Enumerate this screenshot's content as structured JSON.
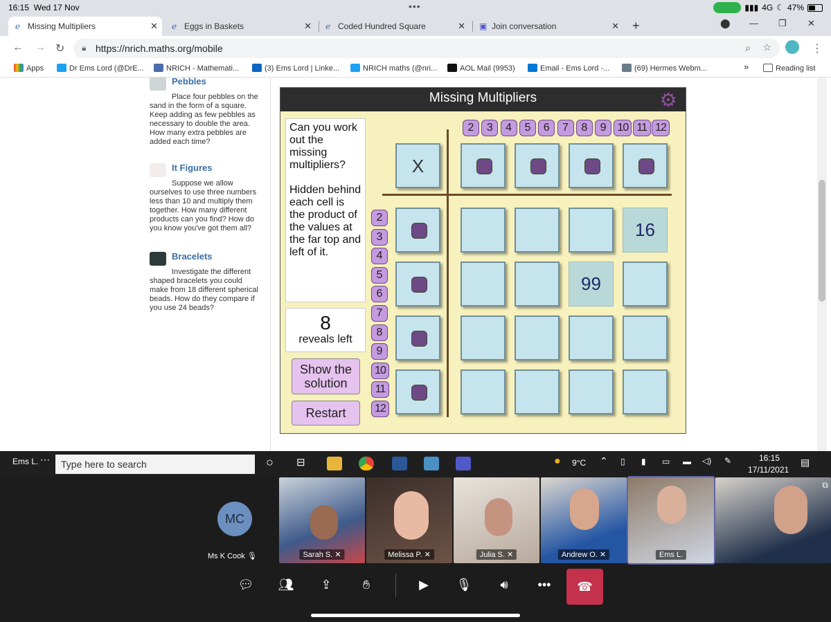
{
  "status": {
    "time": "16:15",
    "date": "Wed 17 Nov",
    "network": "4G",
    "battery": "47%"
  },
  "tabs": [
    {
      "label": "Missing Multipliers",
      "active": true
    },
    {
      "label": "Eggs in Baskets"
    },
    {
      "label": "Coded Hundred Square"
    },
    {
      "label": "Join conversation"
    }
  ],
  "address": {
    "url": "https://nrich.maths.org/mobile"
  },
  "bookmarks": {
    "apps": "Apps",
    "items": [
      "Dr Ems Lord (@DrE...",
      "NRICH - Mathemati...",
      "(3) Ems Lord | Linke...",
      "NRICH maths (@nri...",
      "AOL Mail (9953)",
      "Email - Ems Lord -...",
      "(69) Hermes Webm..."
    ],
    "more": "»",
    "reading_list": "Reading list"
  },
  "sidebar": {
    "items": [
      {
        "title": "Pebbles",
        "text": "Place four pebbles on the sand in the form of a square. Keep adding as few pebbles as necessary to double the area. How many extra pebbles are added each time?"
      },
      {
        "title": "It Figures",
        "text": "Suppose we allow ourselves to use three numbers less than 10 and multiply them together. How many different products can you find? How do you know you've got them all?"
      },
      {
        "title": "Bracelets",
        "text": "Investigate the different shaped bracelets you could make from 18 different spherical beads. How do they compare if you use 24 beads?"
      }
    ]
  },
  "game": {
    "title": "Missing Multipliers",
    "question": "Can you work out the missing multipliers?\n\nHidden behind each cell is the product of the values at the far top and left of it.",
    "reveals": "8",
    "reveals_label": "reveals left",
    "show_solution": "Show the solution",
    "restart": "Restart",
    "top_numbers": [
      "2",
      "3",
      "4",
      "5",
      "6",
      "7",
      "8",
      "9",
      "10",
      "11",
      "12"
    ],
    "left_numbers": [
      "2",
      "3",
      "4",
      "5",
      "6",
      "7",
      "8",
      "9",
      "10",
      "11",
      "12"
    ],
    "corner": "X",
    "revealed": {
      "r0c3": "16",
      "r1c2": "99"
    }
  },
  "taskbar": {
    "user": "Ems L.",
    "search_placeholder": "Type here to search",
    "weather": "9°C",
    "time": "16:15",
    "date": "17/11/2021"
  },
  "teams": {
    "local": {
      "initials": "MC",
      "name": "Ms K Cook"
    },
    "participants": [
      "Sarah S.",
      "Melissa P.",
      "Julia S.",
      "Andrew O.",
      "Ems L."
    ]
  }
}
